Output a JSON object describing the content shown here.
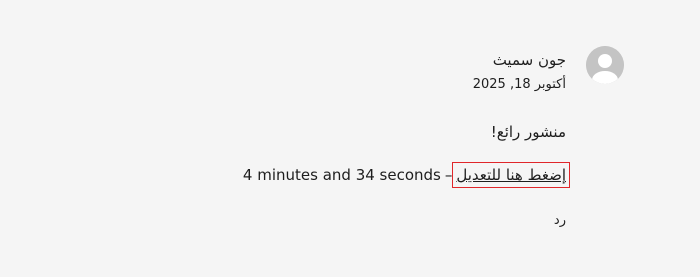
{
  "comment": {
    "avatar_icon": "user-silhouette-icon",
    "author": "جون سميث",
    "date": "أكتوبر 18, 2025",
    "text": "منشور رائع!",
    "edit_link_label": "إضغط هنا للتعديل",
    "edit_separator": "–",
    "edit_time_remaining": "4 minutes and 34 seconds",
    "reply_label": "رد"
  },
  "colors": {
    "background": "#f5f5f5",
    "text": "#1e1e1e",
    "avatar": "#c4c4c4",
    "highlight_border": "#e0262a"
  }
}
